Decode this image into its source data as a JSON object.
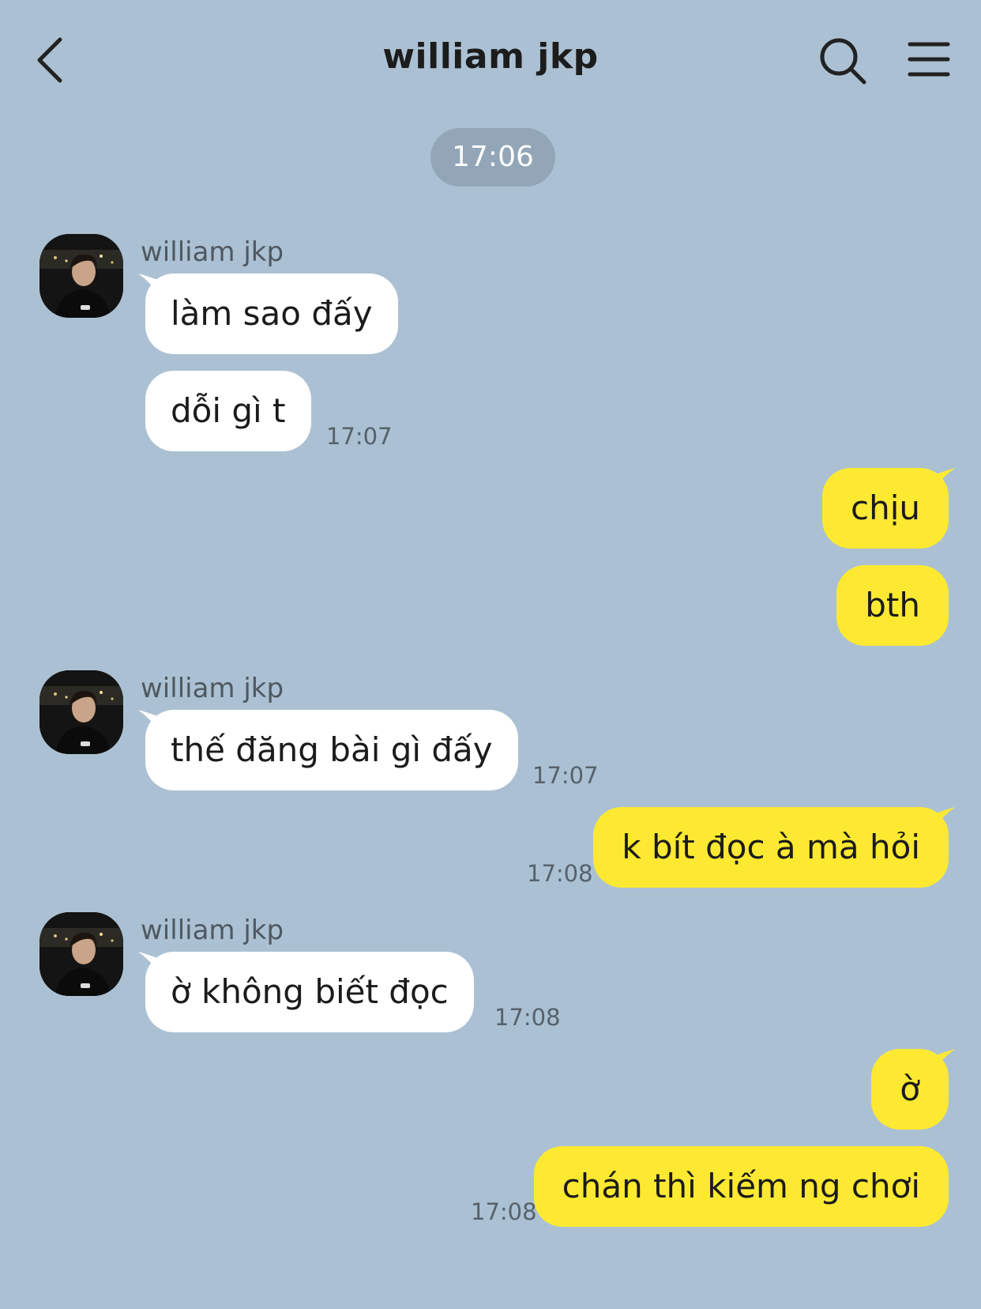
{
  "header": {
    "title": "william jkp",
    "back_icon": "chevron-left-icon",
    "search_icon": "search-icon",
    "menu_icon": "hamburger-menu-icon"
  },
  "date_divider": "17:06",
  "colors": {
    "background": "#abc1d3",
    "incoming_bubble": "#ffffff",
    "outgoing_bubble": "#fde931",
    "divider_pill": "#92a6b7"
  },
  "messages": {
    "g1": {
      "sender": "william jkp",
      "m1": "làm sao đấy",
      "m2": "dỗi gì t",
      "time": "17:07"
    },
    "g2": {
      "m1": "chịu",
      "m2": "bth"
    },
    "g3": {
      "sender": "william jkp",
      "m1": "thế đăng bài gì đấy",
      "time": "17:07"
    },
    "g4": {
      "m1": "k bít đọc à mà hỏi",
      "time": "17:08"
    },
    "g5": {
      "sender": "william jkp",
      "m1": "ờ không biết đọc",
      "time": "17:08"
    },
    "g6": {
      "m1": "ờ",
      "m2": "chán thì kiếm ng chơi",
      "time": "17:08"
    }
  }
}
